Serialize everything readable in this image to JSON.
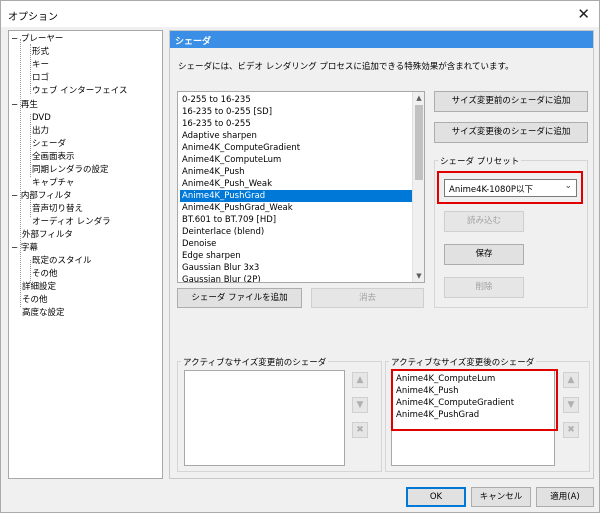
{
  "window": {
    "title": "オプション",
    "close_glyph": "✕"
  },
  "tree": {
    "items": [
      {
        "label": "プレーヤー",
        "expander": "−"
      },
      {
        "label": "形式"
      },
      {
        "label": "キー"
      },
      {
        "label": "ロゴ"
      },
      {
        "label": "ウェブ インターフェイス"
      },
      {
        "label": "再生",
        "expander": "−"
      },
      {
        "label": "DVD"
      },
      {
        "label": "出力"
      },
      {
        "label": "シェーダ"
      },
      {
        "label": "全画面表示"
      },
      {
        "label": "同期レンダラの設定"
      },
      {
        "label": "キャプチャ"
      },
      {
        "label": "内部フィルタ",
        "expander": "−"
      },
      {
        "label": "音声切り替え"
      },
      {
        "label": "オーディオ レンダラ"
      },
      {
        "label": "外部フィルタ"
      },
      {
        "label": "字幕",
        "expander": "−"
      },
      {
        "label": "既定のスタイル"
      },
      {
        "label": "その他"
      },
      {
        "label": "詳細設定"
      },
      {
        "label": "その他"
      },
      {
        "label": "高度な設定"
      }
    ]
  },
  "panel": {
    "header": "シェーダ",
    "description": "シェーダには、ビデオ レンダリング プロセスに追加できる特殊効果が含まれています。",
    "shader_list": [
      "0-255 to 16-235",
      "16-235 to 0-255 [SD]",
      "16-235 to 0-255",
      "Adaptive sharpen",
      "Anime4K_ComputeGradient",
      "Anime4K_ComputeLum",
      "Anime4K_Push",
      "Anime4K_Push_Weak",
      "Anime4K_PushGrad",
      "Anime4K_PushGrad_Weak",
      "BT.601 to BT.709 [HD]",
      "Deinterlace (blend)",
      "Denoise",
      "Edge sharpen",
      "Gaussian Blur 3x3",
      "Gaussian Blur (2P)"
    ],
    "selected_shader": "Anime4K_PushGrad",
    "add_shader_file": "シェーダ ファイルを追加",
    "remove": "消去",
    "add_pre_resize": "サイズ変更前のシェーダに追加",
    "add_post_resize": "サイズ変更後のシェーダに追加",
    "preset_group": "シェーダ プリセット",
    "preset_value": "Anime4K-1080P以下",
    "load": "読み込む",
    "save": "保存",
    "delete": "削除",
    "pre_group": "アクティブなサイズ変更前のシェーダ",
    "post_group": "アクティブなサイズ変更後のシェーダ",
    "post_list": [
      "Anime4K_ComputeLum",
      "Anime4K_Push",
      "Anime4K_ComputeGradient",
      "Anime4K_PushGrad"
    ],
    "up_glyph": "▲",
    "down_glyph": "▼",
    "remove_glyph": "✖"
  },
  "footer": {
    "ok": "OK",
    "cancel": "キャンセル",
    "apply": "適用(A)"
  },
  "colors": {
    "accent": "#0078d7",
    "header": "#3a8ee6",
    "highlight": "#e00000"
  }
}
